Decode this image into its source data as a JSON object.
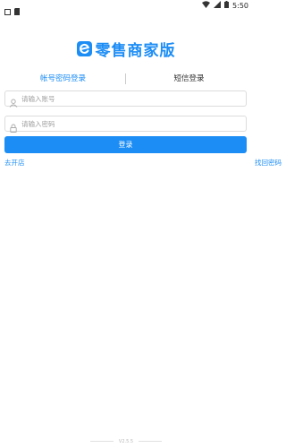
{
  "status_bar": {
    "time": "5:50",
    "icons": [
      "notification-icon",
      "sd-card-icon",
      "wifi-icon",
      "signal-icon",
      "battery-icon"
    ]
  },
  "brand": {
    "title": "零售商家版",
    "logo_icon": "e-logo-icon",
    "color": "#1c8df5"
  },
  "tabs": [
    {
      "label": "帐号密码登录",
      "active": true
    },
    {
      "label": "短信登录",
      "active": false
    }
  ],
  "form": {
    "account": {
      "placeholder": "请输入账号",
      "value": "",
      "icon": "user-icon"
    },
    "password": {
      "placeholder": "请输入密码",
      "value": "",
      "icon": "lock-icon"
    },
    "login_label": "登录"
  },
  "links": {
    "open_store": "去开店",
    "find_password": "找回密码"
  },
  "footer": {
    "version": "V2.5.5"
  },
  "colors": {
    "accent": "#1c8df5",
    "border": "#dcdcdc",
    "placeholder": "#a0a0a0"
  }
}
